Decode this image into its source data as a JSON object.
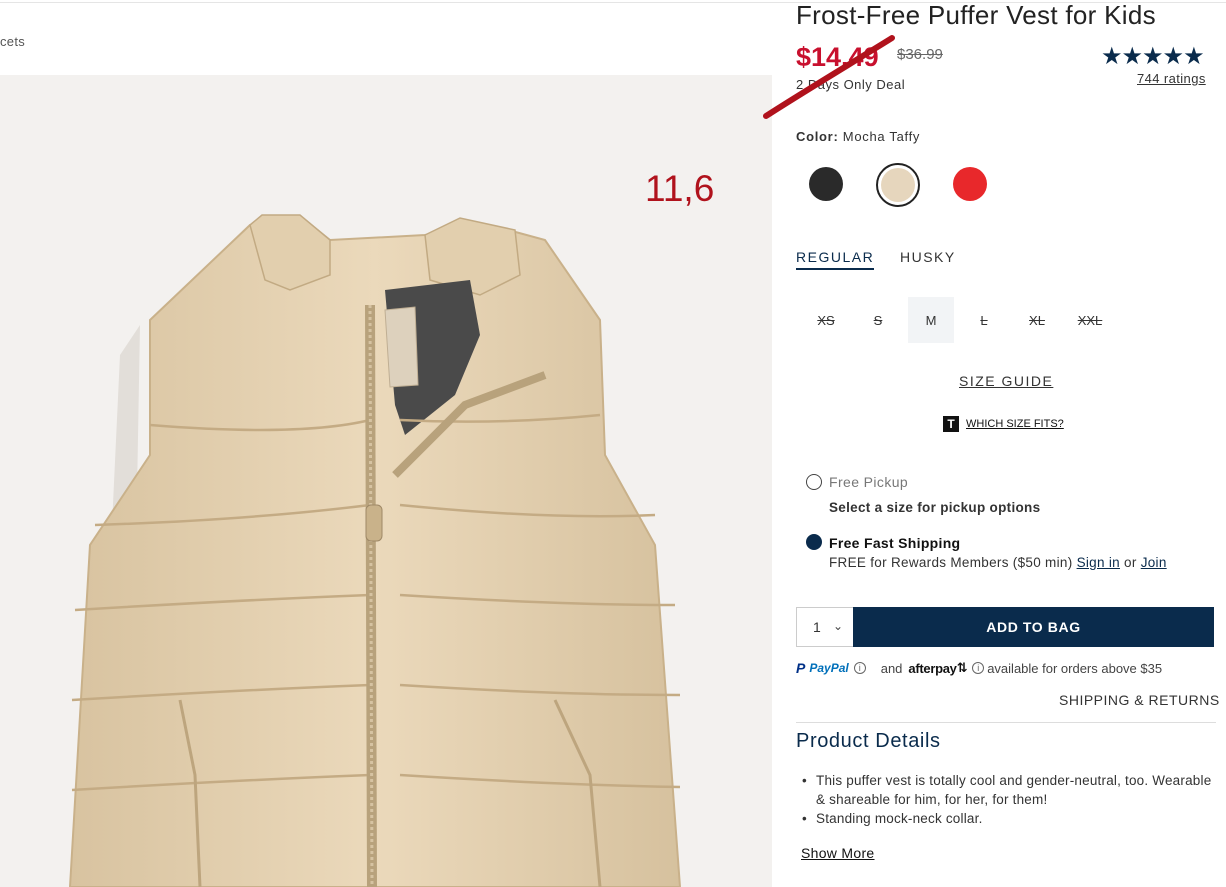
{
  "breadcrumb": "cets",
  "annotation": "11,6",
  "product": {
    "title": "Frost-Free Puffer Vest for Kids",
    "sale_price": "$14.49",
    "original_price": "$36.99",
    "deal_text": "2 Days Only Deal",
    "stars": "★★★★★",
    "rating_value": 4.8,
    "ratings_link": "744 ratings"
  },
  "color": {
    "label": "Color:",
    "selected": "Mocha Taffy",
    "swatches": [
      {
        "name": "black",
        "hex": "#2a2a2a"
      },
      {
        "name": "mocha-taffy",
        "hex": "#e6d6bd",
        "selected": true
      },
      {
        "name": "red",
        "hex": "#e8282b"
      }
    ]
  },
  "fit": {
    "tabs": [
      "REGULAR",
      "HUSKY"
    ],
    "selected": "REGULAR"
  },
  "sizes": [
    {
      "label": "XS",
      "available": false
    },
    {
      "label": "S",
      "available": false
    },
    {
      "label": "M",
      "available": true
    },
    {
      "label": "L",
      "available": false
    },
    {
      "label": "XL",
      "available": false
    },
    {
      "label": "XXL",
      "available": false
    }
  ],
  "size_guide": "SIZE GUIDE",
  "which_size": {
    "icon": "T",
    "label": "WHICH SIZE FITS?"
  },
  "fulfillment": {
    "pickup_label": "Free Pickup",
    "pickup_sub": "Select a size for pickup options",
    "shipping_label": "Free Fast Shipping",
    "shipping_sub": "FREE for Rewards Members ($50 min)",
    "sign_in": "Sign in",
    "or": "or",
    "join": "Join"
  },
  "cart": {
    "quantity": "1",
    "add_to_bag": "ADD TO BAG"
  },
  "payments": {
    "paypal": "PayPal",
    "and": "and",
    "afterpay": "afterpay",
    "available_text": "available for orders above $35"
  },
  "shipping_returns": "SHIPPING & RETURNS",
  "details": {
    "title": "Product Details",
    "items": [
      "This puffer vest is totally cool and gender-neutral, too. Wearable & shareable for him, for her, for them!",
      "Standing mock-neck collar."
    ],
    "show_more": "Show More"
  },
  "colors": {
    "navy": "#0a2b4c",
    "sale_red": "#c8102e",
    "annotation_red": "#b0121c"
  }
}
